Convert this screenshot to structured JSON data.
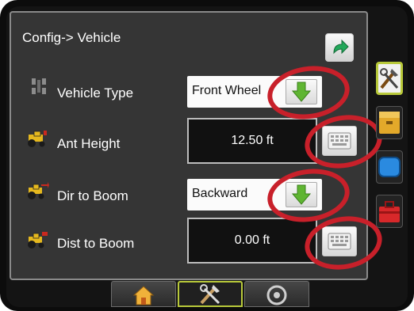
{
  "header": {
    "title": "Config-> Vehicle"
  },
  "rows": [
    {
      "label": "Vehicle Type",
      "control": "dropdown",
      "value": "Front Wheel"
    },
    {
      "label": "Ant Height",
      "control": "keyboard",
      "value": "12.50 ft"
    },
    {
      "label": "Dir to Boom",
      "control": "dropdown",
      "value": "Backward"
    },
    {
      "label": "Dist to Boom",
      "control": "keyboard",
      "value": "0.00 ft"
    }
  ],
  "side_tabs": [
    {
      "name": "tools",
      "selected": true
    },
    {
      "name": "storage",
      "selected": false
    },
    {
      "name": "display",
      "selected": false
    },
    {
      "name": "toolbox",
      "selected": false
    }
  ],
  "bottom_tabs": [
    {
      "name": "home",
      "selected": false
    },
    {
      "name": "setup",
      "selected": true
    },
    {
      "name": "guidance",
      "selected": false
    }
  ],
  "colors": {
    "panel_bg": "#353535",
    "highlight_ring": "#c8202a",
    "dropdown_arrow": "#5fb532",
    "back_arrow": "#22a85a",
    "selected_tab_border": "#b8c93a"
  }
}
